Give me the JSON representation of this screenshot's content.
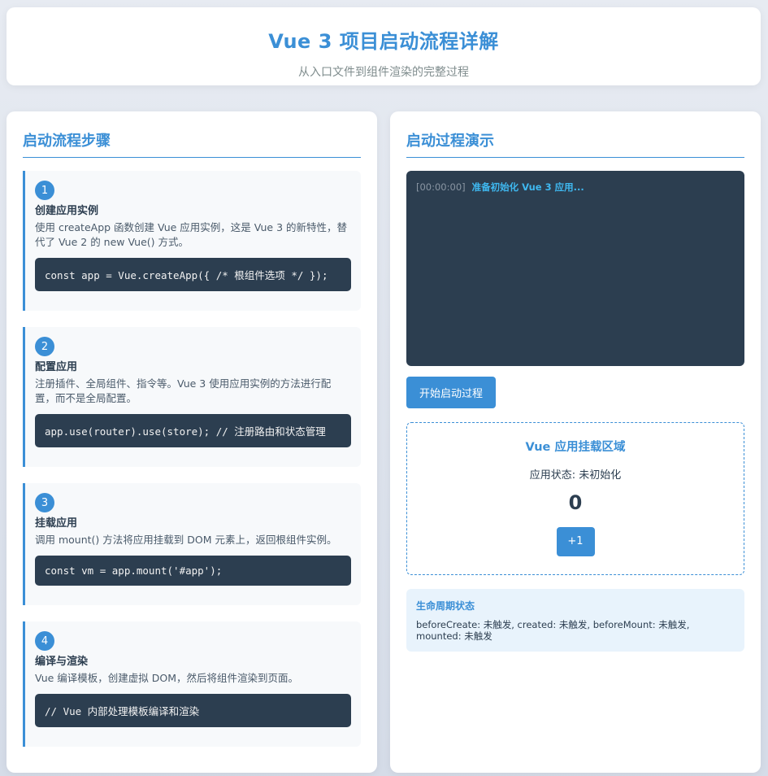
{
  "header": {
    "title": "Vue 3 项目启动流程详解",
    "subtitle": "从入口文件到组件渲染的完整过程"
  },
  "left": {
    "title": "启动流程步骤",
    "steps": [
      {
        "num": "1",
        "title": "创建应用实例",
        "desc": "使用 createApp 函数创建 Vue 应用实例，这是 Vue 3 的新特性，替代了 Vue 2 的 new Vue() 方式。",
        "code": "const app = Vue.createApp({ /* 根组件选项 */ });"
      },
      {
        "num": "2",
        "title": "配置应用",
        "desc": "注册插件、全局组件、指令等。Vue 3 使用应用实例的方法进行配置，而不是全局配置。",
        "code": "app.use(router).use(store); // 注册路由和状态管理"
      },
      {
        "num": "3",
        "title": "挂载应用",
        "desc": "调用 mount() 方法将应用挂载到 DOM 元素上，返回根组件实例。",
        "code": "const vm = app.mount('#app');"
      },
      {
        "num": "4",
        "title": "编译与渲染",
        "desc": "Vue 编译模板，创建虚拟 DOM，然后将组件渲染到页面。",
        "code": "// Vue 内部处理模板编译和渲染"
      }
    ]
  },
  "right": {
    "title": "启动过程演示",
    "console": {
      "time": "[00:00:00]",
      "message": "准备初始化 Vue 3 应用..."
    },
    "start_button": "开始启动过程",
    "mount": {
      "title": "Vue 应用挂载区域",
      "state": "应用状态: 未初始化",
      "count": "0",
      "plus_button": "+1"
    },
    "lifecycle": {
      "title": "生命周期状态",
      "text": "beforeCreate: 未触发, created: 未触发, beforeMount: 未触发, mounted: 未触发"
    }
  },
  "colors": {
    "accent": "#3b8fd6",
    "dark": "#2c3e50",
    "console_text": "#3fb8f0"
  }
}
